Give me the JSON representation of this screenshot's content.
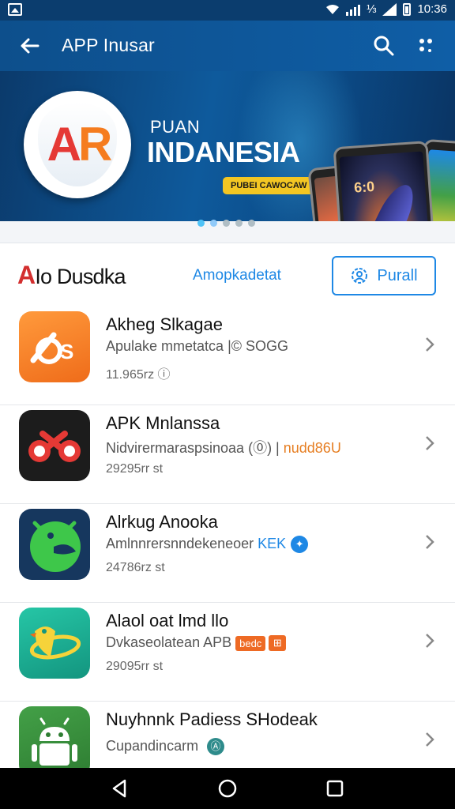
{
  "status_bar": {
    "extra": "⅓",
    "time": "10:36",
    "icons": [
      "gallery-icon",
      "wifi-icon",
      "signal-icon",
      "network-icon",
      "battery-icon"
    ]
  },
  "app_bar": {
    "title": "APP Inusar",
    "icons": [
      "back-arrow-icon",
      "search-icon",
      "more-icon"
    ]
  },
  "banner": {
    "logo_text_a": "A",
    "logo_text_r": "R",
    "small_text": "PUAN",
    "big_text": "INDANESIA",
    "pill_text": "PUBEI CAWOCAW",
    "phone_clock": "6:0",
    "dots_total": 5,
    "active_dot": 1
  },
  "filter_bar": {
    "brand_prefix": "A",
    "brand_name": "Io Dusdka",
    "link_text": "Amopkadetat",
    "button_label": "Purall"
  },
  "apps": [
    {
      "name": "Akheg Slkagae",
      "desc": "Apulake mmetatca |© SOGG",
      "meta": "11.965rz ⓘ",
      "icon": "app-orange-icon"
    },
    {
      "name": "APK Mnlanssa",
      "desc_main": "Nidvirermaraspsinoaa (⓪) | ",
      "desc_tag": "nudd86U",
      "meta": "29295rr st",
      "icon": "app-red-eyes-icon"
    },
    {
      "name": "Alrkug Anooka",
      "desc_main": "Amlnnrersnndekeneoer ",
      "desc_tag": "KEK",
      "desc_badge": "✦",
      "meta": "24786rz st",
      "icon": "app-green-dino-icon"
    },
    {
      "name": "Alaol oat lmd llo",
      "desc_main": "Dvkaseolatean APB ",
      "desc_badge": "bedc",
      "desc_badge2": "⊞",
      "meta": "29095rr st",
      "icon": "app-teal-bird-icon"
    },
    {
      "name": "Nuyhnnk Padiess SHodeak",
      "desc_main": "Cupandincarm ",
      "desc_badge": "Ⓐ",
      "icon": "android-icon"
    }
  ],
  "nav_bar": {
    "icons": [
      "nav-back-icon",
      "nav-home-icon",
      "nav-recents-icon"
    ]
  },
  "colors": {
    "primary": "#0f5ea6",
    "accent": "#1e88e5",
    "orange": "#ee6a24"
  }
}
